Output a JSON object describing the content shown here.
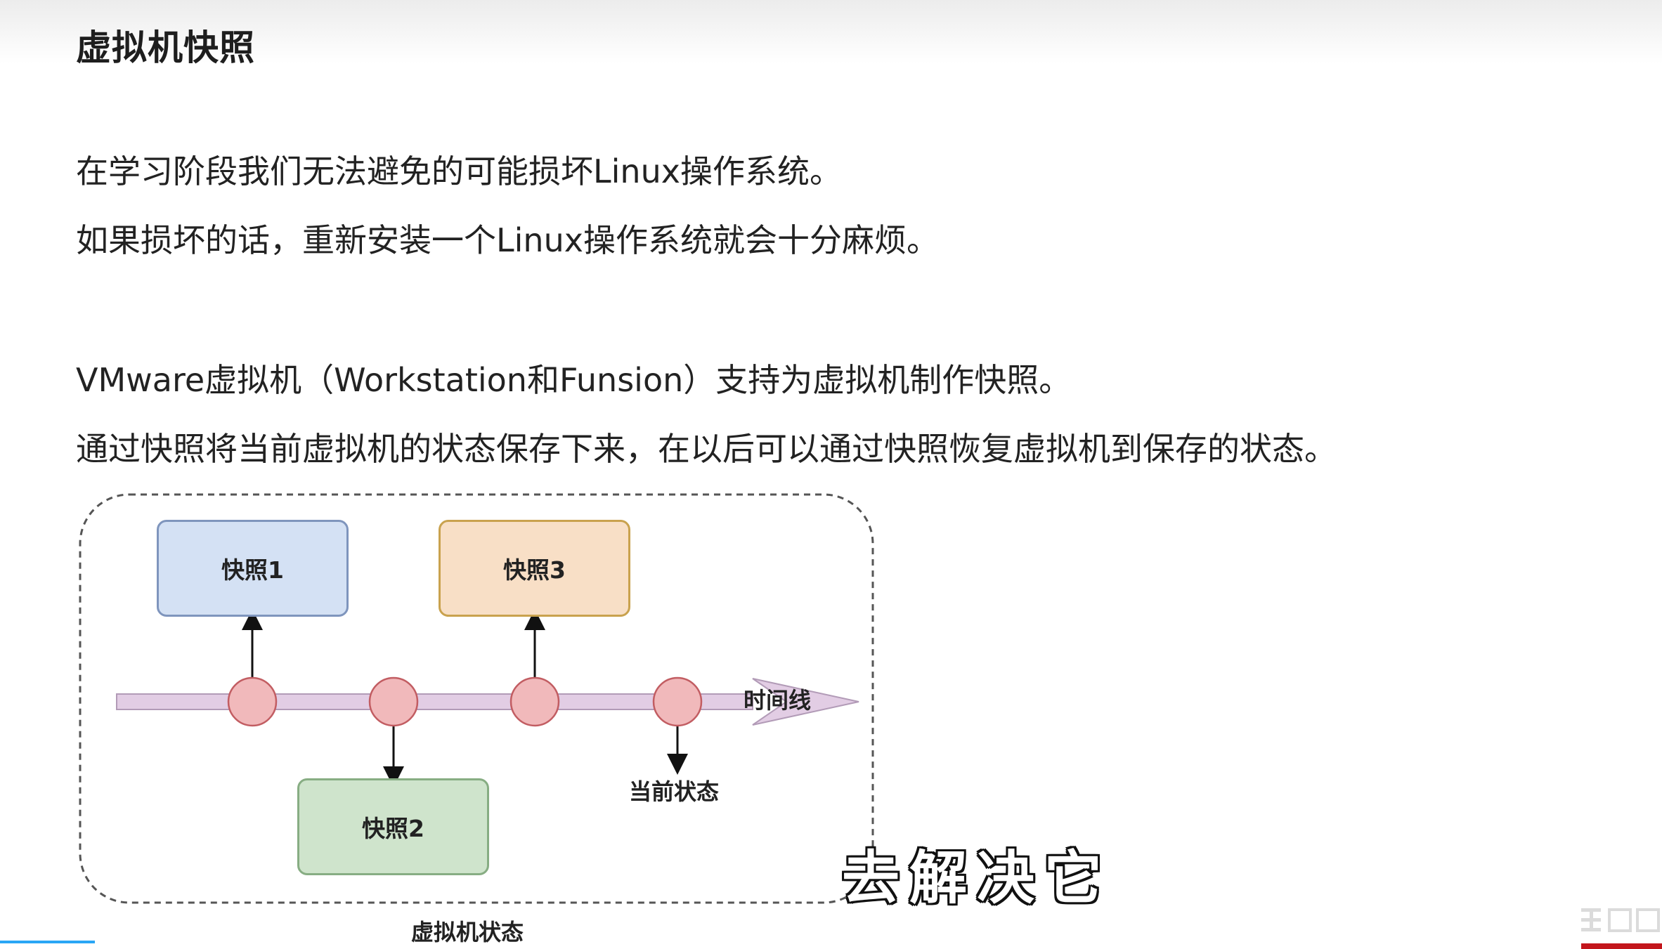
{
  "page": {
    "title": "虚拟机快照",
    "paragraphs": [
      "在学习阶段我们无法避免的可能损坏Linux操作系统。",
      "如果损坏的话，重新安装一个Linux操作系统就会十分麻烦。",
      "VMware虚拟机（Workstation和Funsion）支持为虚拟机制作快照。",
      "通过快照将当前虚拟机的状态保存下来，在以后可以通过快照恢复虚拟机到保存的状态。"
    ]
  },
  "diagram": {
    "snapshots": [
      "快照1",
      "快照2",
      "快照3"
    ],
    "timeline_label": "时间线",
    "current_state_label": "当前状态",
    "container_label": "虚拟机状态",
    "colors": {
      "snapshot1": "#d4e1f4",
      "snapshot2": "#cfe4cc",
      "snapshot3": "#f8dfc6",
      "timeline": "#e2cde4",
      "node": "#f1b9bb"
    }
  },
  "subtitle": "去解决它"
}
